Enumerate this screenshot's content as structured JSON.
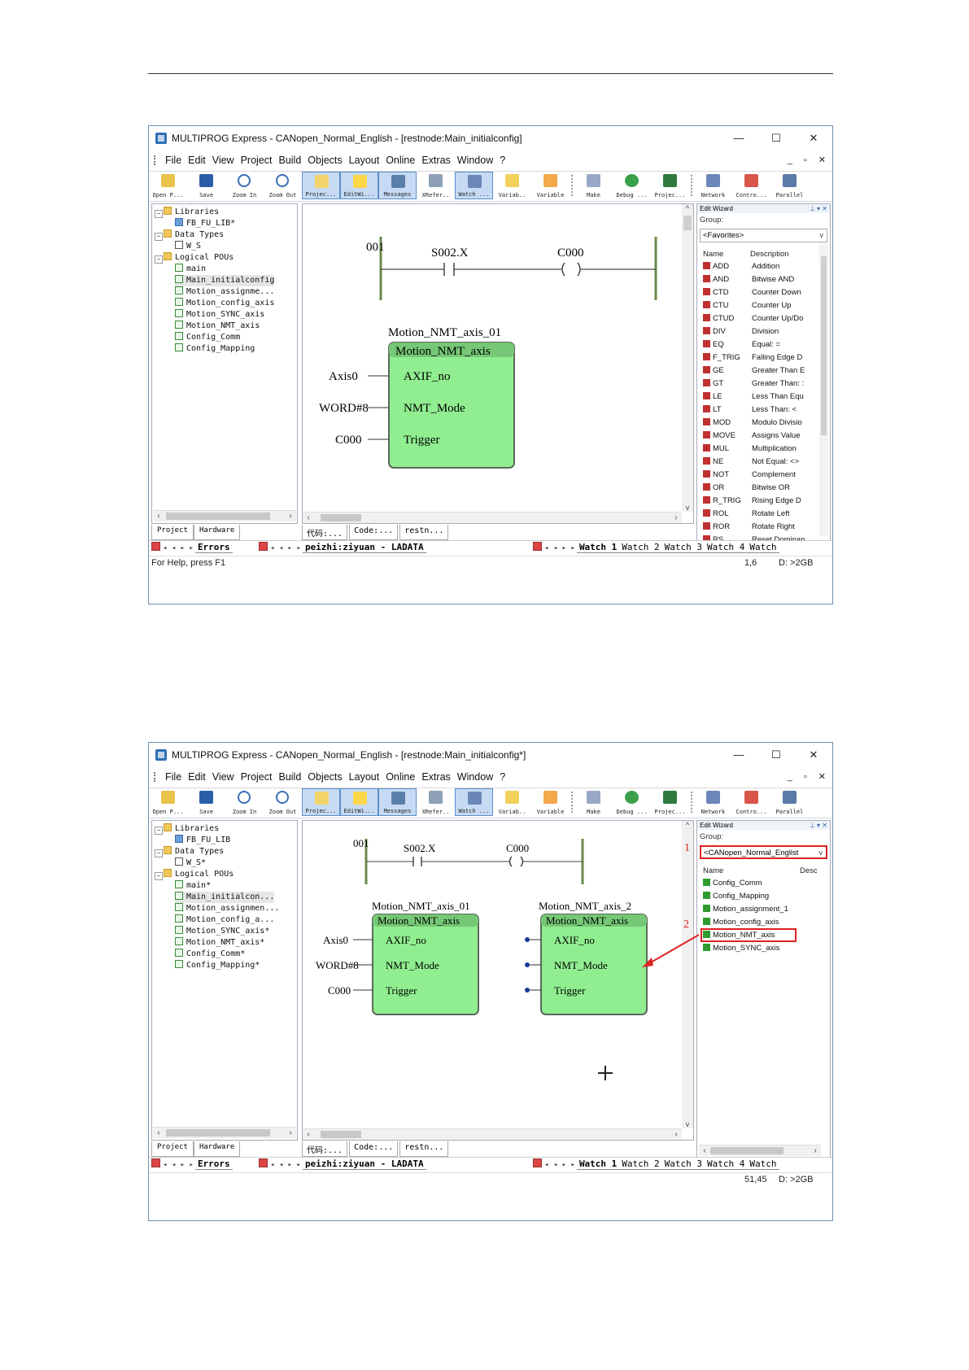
{
  "screenshots": [
    {
      "title": "MULTIPROG Express - CANopen_Normal_English - [restnode:Main_initialconfig]",
      "menu": [
        "File",
        "Edit",
        "View",
        "Project",
        "Build",
        "Objects",
        "Layout",
        "Online",
        "Extras",
        "Window",
        "?"
      ],
      "toolbar": [
        "Open P...",
        "Save",
        "Zoom In",
        "Zoom Out",
        "Projec...",
        "EditWi...",
        "Messages",
        "XRefer..",
        "Watch ...",
        "Variab..",
        "Variable",
        "Make",
        "Debug ...",
        "Projec...",
        "Network",
        "Contro...",
        "Parallel"
      ],
      "tree": {
        "libraries": "Libraries",
        "lib_item": "FB_FU_LIB*",
        "data_types": "Data Types",
        "type_item": "W_S",
        "logical_pous": "Logical POUs",
        "pous": [
          "main",
          "Main_initialconfig",
          "Motion_assignme...",
          "Motion_config_axis",
          "Motion_SYNC_axis",
          "Motion_NMT_axis",
          "Config_Comm",
          "Config_Mapping"
        ]
      },
      "left_tabs": [
        "Project",
        "Hardware"
      ],
      "ladder": {
        "rung_label": "001",
        "contact": "S002.X",
        "coil": "C000"
      },
      "fbs": [
        {
          "instance": "Motion_NMT_axis_01",
          "type": "Motion_NMT_axis",
          "inputs": [
            "AXIF_no",
            "NMT_Mode",
            "Trigger"
          ],
          "connections": [
            "Axis0",
            "WORD#8",
            "C000"
          ]
        }
      ],
      "editor_tabs": [
        "代码:...",
        "Code:...",
        "restn..."
      ],
      "edit_wizard": {
        "title": "Edit Wizard",
        "group_label": "Group:",
        "group_value": "<Favorites>",
        "col_name": "Name",
        "col_desc": "Description",
        "items": [
          {
            "name": "ADD",
            "desc": "Addition"
          },
          {
            "name": "AND",
            "desc": "Bitwise AND"
          },
          {
            "name": "CTD",
            "desc": "Counter Down"
          },
          {
            "name": "CTU",
            "desc": "Counter Up"
          },
          {
            "name": "CTUD",
            "desc": "Counter Up/Do"
          },
          {
            "name": "DIV",
            "desc": "Division"
          },
          {
            "name": "EQ",
            "desc": "Equal: ="
          },
          {
            "name": "F_TRIG",
            "desc": "Falling Edge D"
          },
          {
            "name": "GE",
            "desc": "Greater Than E"
          },
          {
            "name": "GT",
            "desc": "Greater Than: :"
          },
          {
            "name": "LE",
            "desc": "Less Than Equ"
          },
          {
            "name": "LT",
            "desc": "Less Than: <"
          },
          {
            "name": "MOD",
            "desc": "Modulo Divisio"
          },
          {
            "name": "MOVE",
            "desc": "Assigns Value"
          },
          {
            "name": "MUL",
            "desc": "Multiplication"
          },
          {
            "name": "NE",
            "desc": "Not Equal: <>"
          },
          {
            "name": "NOT",
            "desc": "Complement"
          },
          {
            "name": "OR",
            "desc": "Bitwise OR"
          },
          {
            "name": "R_TRIG",
            "desc": "Rising Edge D"
          },
          {
            "name": "ROL",
            "desc": "Rotate Left"
          },
          {
            "name": "ROR",
            "desc": "Rotate Right"
          },
          {
            "name": "RS",
            "desc": "Reset Dominan"
          }
        ]
      },
      "bottom": {
        "errors": "Errors",
        "path": "peizhi:ziyuan - LADATA",
        "watch": [
          "Watch 1",
          "Watch 2",
          "Watch 3",
          "Watch 4",
          "Watch"
        ]
      },
      "status": {
        "help": "For Help, press F1",
        "pos": "1,6",
        "mem": "D: >2GB"
      }
    },
    {
      "title": "MULTIPROG Express - CANopen_Normal_English - [restnode:Main_initialconfig*]",
      "menu": [
        "File",
        "Edit",
        "View",
        "Project",
        "Build",
        "Objects",
        "Layout",
        "Online",
        "Extras",
        "Window",
        "?"
      ],
      "toolbar": [
        "Open P...",
        "Save",
        "Zoom In",
        "Zoom Out",
        "Projec...",
        "EditWi...",
        "Messages",
        "XRefer..",
        "Watch ...",
        "Variab..",
        "Variable",
        "Make",
        "Debug ...",
        "Projec...",
        "Network",
        "Contro...",
        "Parallel"
      ],
      "tree": {
        "libraries": "Libraries",
        "lib_item": "FB_FU_LIB",
        "data_types": "Data Types",
        "type_item": "W_S*",
        "logical_pous": "Logical POUs",
        "pous": [
          "main*",
          "Main_initialcon...",
          "Motion_assignmen...",
          "Motion_config_a...",
          "Motion_SYNC_axis*",
          "Motion_NMT_axis*",
          "Config_Comm*",
          "Config_Mapping*"
        ]
      },
      "left_tabs": [
        "Project",
        "Hardware"
      ],
      "ladder": {
        "rung_label": "001",
        "contact": "S002.X",
        "coil": "C000"
      },
      "fbs": [
        {
          "instance": "Motion_NMT_axis_01",
          "type": "Motion_NMT_axis",
          "inputs": [
            "AXIF_no",
            "NMT_Mode",
            "Trigger"
          ],
          "connections": [
            "Axis0",
            "WORD#8",
            "C000"
          ]
        },
        {
          "instance": "Motion_NMT_axis_2",
          "type": "Motion_NMT_axis",
          "inputs": [
            "AXIF_no",
            "NMT_Mode",
            "Trigger"
          ],
          "connections": [
            "",
            "",
            ""
          ]
        }
      ],
      "editor_tabs": [
        "代码:...",
        "Code:...",
        "restn..."
      ],
      "edit_wizard": {
        "title": "Edit Wizard",
        "group_label": "Group:",
        "group_value": "<CANopen_Normal_Englist",
        "col_name": "Name",
        "col_desc": "Desc",
        "items": [
          {
            "name": "Config_Comm",
            "desc": ""
          },
          {
            "name": "Config_Mapping",
            "desc": ""
          },
          {
            "name": "Motion_assignment_1",
            "desc": ""
          },
          {
            "name": "Motion_config_axis",
            "desc": ""
          },
          {
            "name": "Motion_NMT_axis",
            "desc": ""
          },
          {
            "name": "Motion_SYNC_axis",
            "desc": ""
          }
        ]
      },
      "annotations": [
        "1",
        "2"
      ],
      "bottom": {
        "errors": "Errors",
        "path": "peizhi:ziyuan - LADATA",
        "watch": [
          "Watch 1",
          "Watch 2",
          "Watch 3",
          "Watch 4",
          "Watch"
        ]
      },
      "status": {
        "help": "",
        "pos": "51,45",
        "mem": "D: >2GB"
      }
    }
  ]
}
